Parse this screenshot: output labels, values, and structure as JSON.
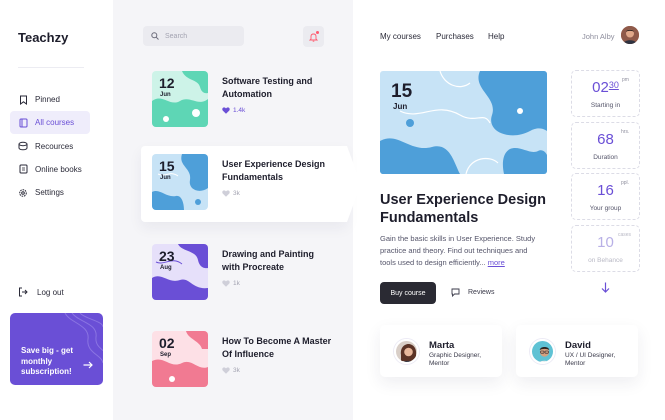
{
  "brand": {
    "name": "Teachzy"
  },
  "sidebar": {
    "items": [
      {
        "label": "Pinned",
        "icon": "bookmark-icon",
        "active": false
      },
      {
        "label": "All courses",
        "icon": "book-icon",
        "active": true
      },
      {
        "label": "Recources",
        "icon": "stack-icon",
        "active": false
      },
      {
        "label": "Online books",
        "icon": "tablet-icon",
        "active": false
      },
      {
        "label": "Settings",
        "icon": "gear-icon",
        "active": false
      }
    ],
    "logout_label": "Log out",
    "promo": {
      "text": "Save big - get monthly subscription!",
      "color": "#6a4fd6"
    }
  },
  "search": {
    "placeholder": "Search"
  },
  "courses": [
    {
      "day": "12",
      "month": "Jun",
      "title": "Software Testing and Automation",
      "likes": "1.4k",
      "liked": true,
      "theme_color": "#5ed6b5"
    },
    {
      "day": "15",
      "month": "Jun",
      "title": "User Experience Design Fundamentals",
      "likes": "3k",
      "liked": false,
      "theme_color": "#4e9fd9"
    },
    {
      "day": "23",
      "month": "Aug",
      "title": "Drawing and Painting with Procreate",
      "likes": "1k",
      "liked": false,
      "theme_color": "#6a4fd6"
    },
    {
      "day": "02",
      "month": "Sep",
      "title": "How To Become A Master Of Influence",
      "likes": "3k",
      "liked": false,
      "theme_color": "#f17a92"
    }
  ],
  "topnav": {
    "links": [
      "My courses",
      "Purchases",
      "Help"
    ],
    "user_name": "John Alby"
  },
  "featured": {
    "day": "15",
    "month": "Jun",
    "title": "User Experience Design Fundamentals",
    "description": "Gain the basic skills in User Experience. Study practice and theory. Find out techniques and tools used to design efficiently...",
    "more_label": "more",
    "buy_label": "Buy course",
    "reviews_label": "Reviews"
  },
  "stats": [
    {
      "value": "02",
      "value_suffix": "30",
      "unit": "pm",
      "label": "Starting in"
    },
    {
      "value": "68",
      "unit": "hrs.",
      "label": "Duration"
    },
    {
      "value": "16",
      "unit": "ppl.",
      "label": "Your group"
    },
    {
      "value": "10",
      "unit": "cases",
      "label": "on Behance"
    }
  ],
  "mentors": [
    {
      "name": "Marta",
      "role": "Graphic Designer, Mentor"
    },
    {
      "name": "David",
      "role": "UX / UI Designer, Mentor"
    }
  ],
  "colors": {
    "accent": "#6a4fd6",
    "dark_button": "#2a2a33",
    "heart": "#6a4fd6"
  }
}
